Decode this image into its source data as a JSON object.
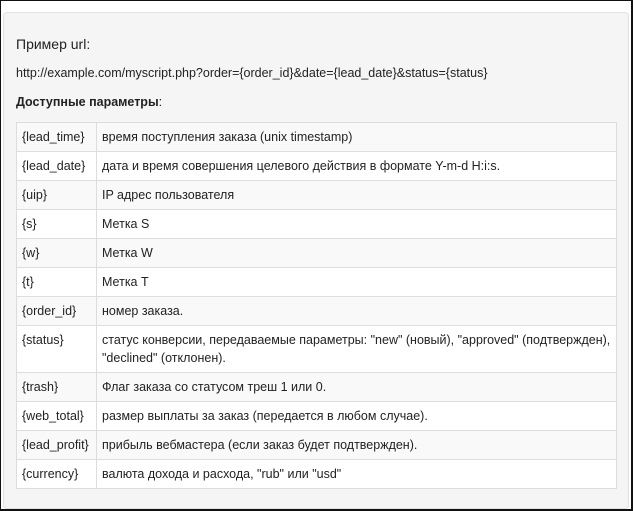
{
  "title": "Пример url:",
  "example_url": "http://example.com/myscript.php?order={order_id}&date={lead_date}&status={status}",
  "params_heading": "Доступные параметры",
  "params_heading_suffix": ":",
  "params": [
    {
      "key": "{lead_time}",
      "desc": "время поступления заказа (unix timestamp)"
    },
    {
      "key": "{lead_date}",
      "desc": "дата и время совершения целевого действия в формате Y-m-d H:i:s."
    },
    {
      "key": "{uip}",
      "desc": "IP адрес пользователя"
    },
    {
      "key": "{s}",
      "desc": "Метка S"
    },
    {
      "key": "{w}",
      "desc": "Метка W"
    },
    {
      "key": "{t}",
      "desc": "Метка T"
    },
    {
      "key": "{order_id}",
      "desc": "номер заказа."
    },
    {
      "key": "{status}",
      "desc": "статус конверсии, передаваемые параметры: \"new\" (новый), \"approved\" (подтвержден), \"declined\" (отклонен)."
    },
    {
      "key": "{trash}",
      "desc": "Флаг заказа со статусом треш 1 или 0."
    },
    {
      "key": "{web_total}",
      "desc": "размер выплаты за заказ (передается в любом случае)."
    },
    {
      "key": "{lead_profit}",
      "desc": "прибыль вебмастера (если заказ будет подтвержден)."
    },
    {
      "key": "{currency}",
      "desc": "валюта дохода и расхода, \"rub\" или \"usd\""
    }
  ]
}
